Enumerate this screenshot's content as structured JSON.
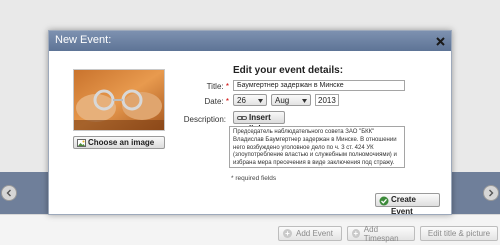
{
  "modal": {
    "title": "New Event:",
    "close_icon": "close-icon",
    "form_heading": "Edit your event details:",
    "choose_image_label": "Choose an image",
    "image_icon": "image-icon",
    "title_label": "Title:",
    "title_value": "Баумгертнер задержан в Минске",
    "date_label": "Date:",
    "required_mark": "*",
    "date": {
      "day": "26",
      "month": "Aug",
      "year": "2013"
    },
    "description_label": "Description:",
    "insert_link_label": "Insert link",
    "link_icon": "link-icon",
    "description_value": "Председатель наблюдательного совета ЗАО \"БКК\" Владислав Баумгертнер задержан в Минске. В отношении него возбуждено уголовное дело по ч. 3 ст. 424 УК (злоупотребление властью и служебным полномочиями) и избрана мера пресечения в виде заключения под стражу.",
    "required_note": "* required fields",
    "create_label": "Create Event",
    "check_icon": "check-icon"
  },
  "background": {
    "add_event_label": "Add Event",
    "add_timespan_label": "Add Timespan",
    "edit_title_label": "Edit title & picture",
    "plus_icon": "plus-icon",
    "nav_left_icon": "chevron-left-icon",
    "nav_right_icon": "chevron-right-icon"
  },
  "colors": {
    "header": "#6a7fa0",
    "band": "#6f7f9a",
    "required": "#cc0000"
  }
}
